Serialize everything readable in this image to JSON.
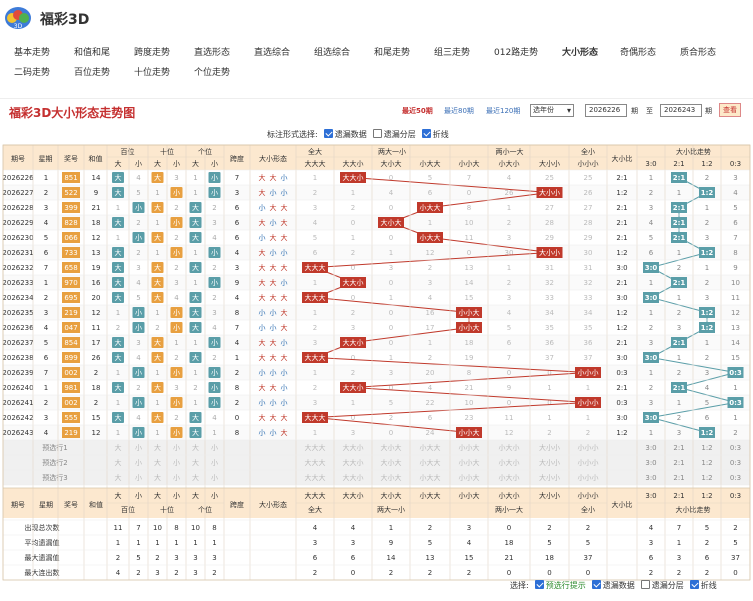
{
  "app": {
    "title": "福彩3D"
  },
  "nav": {
    "row1": [
      "基本走势",
      "和值和尾",
      "跨度走势",
      "直选形态",
      "直选综合",
      "组选综合",
      "和尾走势",
      "组三走势",
      "012路走势",
      "大小形态",
      "奇偶形态",
      "质合形态"
    ],
    "row2": [
      "二码走势",
      "百位走势",
      "十位走势",
      "个位走势"
    ],
    "active": "大小形态"
  },
  "chart": {
    "title": "福彩3D大小形态走势图",
    "periods": [
      "最近50期",
      "最近80期",
      "最近120期"
    ],
    "active_period": "最近50期",
    "year_select": "选年份",
    "from_issue": "2026226",
    "to_issue": "2026243",
    "issue_suffix": "期",
    "to_label": "至",
    "query_label": "查看"
  },
  "options_top": {
    "label": "标注形式选择:",
    "items": [
      {
        "label": "遗漏数据",
        "checked": true
      },
      {
        "label": "遗漏分层",
        "checked": false
      },
      {
        "label": "折线",
        "checked": true
      }
    ]
  },
  "options_bottom": {
    "label": "选择:",
    "items": [
      {
        "label": "预选行提示",
        "checked": true,
        "accent": "#2e8b2e"
      },
      {
        "label": "遗漏数据",
        "checked": true
      },
      {
        "label": "遗漏分层",
        "checked": false
      },
      {
        "label": "折线",
        "checked": true
      }
    ]
  },
  "table": {
    "top_headers": {
      "issue": "期号",
      "week": "星期",
      "prize": "奖号",
      "sum": "和值",
      "hundreds": "百位",
      "tens": "十位",
      "units": "个位",
      "span": "跨度",
      "shape": "大小形态",
      "g_all_big": "全大",
      "g_2b1s": "两大一小",
      "g_2s1b": "两小一大",
      "g_all_small": "全小",
      "ratio": "大小比",
      "trend": "大小比走势"
    },
    "sub": {
      "big": "大",
      "small": "小",
      "all_big": "大大大",
      "s2b1s": [
        "大大小",
        "大小大",
        "小大大"
      ],
      "s2s1b": [
        "小小大",
        "小大小",
        "大小小"
      ],
      "all_small": "小小小",
      "trend": [
        "3:0",
        "2:1",
        "1:2",
        "0:3"
      ]
    },
    "rows": [
      {
        "issue": "2026226",
        "week": "1",
        "prize": "851",
        "sum": "14",
        "pos": [
          "大",
          "大",
          "小"
        ],
        "miss_b": [
          1,
          4
        ],
        "miss_t": [
          1,
          3
        ],
        "miss_u": [
          1,
          3
        ],
        "span": "7",
        "shape": [
          "大",
          "大",
          "小"
        ],
        "miss_shape": [
          1,
          0,
          5,
          7,
          4,
          25
        ],
        "ratio": "2:1",
        "trend_miss": [
          1,
          0,
          2,
          3
        ]
      },
      {
        "issue": "2026227",
        "week": "2",
        "prize": "522",
        "sum": "9",
        "pos": [
          "大",
          "小",
          "小"
        ],
        "miss_b": [
          2,
          5
        ],
        "miss_t": [
          1,
          1
        ],
        "miss_u": [
          1,
          1
        ],
        "span": "3",
        "shape": [
          "大",
          "小",
          "小"
        ],
        "miss_shape": [
          2,
          1,
          4,
          6,
          0,
          26
        ],
        "ratio": "1:2",
        "trend_miss": [
          2,
          1,
          0,
          4
        ]
      },
      {
        "issue": "2026228",
        "week": "3",
        "prize": "399",
        "sum": "21",
        "pos": [
          "小",
          "大",
          "大"
        ],
        "miss_b": [
          1,
          1
        ],
        "miss_t": [
          1,
          2
        ],
        "miss_u": [
          2,
          2
        ],
        "span": "6",
        "shape": [
          "小",
          "大",
          "大"
        ],
        "miss_shape": [
          3,
          2,
          0,
          8,
          1,
          27
        ],
        "ratio": "2:1",
        "trend_miss": [
          3,
          0,
          1,
          5
        ]
      },
      {
        "issue": "2026229",
        "week": "4",
        "prize": "828",
        "sum": "18",
        "pos": [
          "大",
          "小",
          "大"
        ],
        "miss_b": [
          2,
          2
        ],
        "miss_t": [
          1,
          1
        ],
        "miss_u": [
          3,
          3
        ],
        "span": "6",
        "shape": [
          "大",
          "小",
          "大"
        ],
        "miss_shape": [
          4,
          0,
          1,
          10,
          2,
          28
        ],
        "ratio": "2:1",
        "trend_miss": [
          4,
          0,
          2,
          6
        ]
      },
      {
        "issue": "2026230",
        "week": "5",
        "prize": "066",
        "sul": "",
        "sum": "12",
        "pos": [
          "小",
          "大",
          "大"
        ],
        "miss_b": [
          1,
          1
        ],
        "miss_t": [
          2,
          2
        ],
        "miss_u": [
          4,
          4
        ],
        "span": "6",
        "shape": [
          "小",
          "大",
          "大"
        ],
        "miss_shape": [
          5,
          1,
          0,
          11,
          3,
          29
        ],
        "ratio": "2:1",
        "trend_miss": [
          5,
          0,
          3,
          7
        ]
      },
      {
        "issue": "2026231",
        "week": "6",
        "prize": "733",
        "sum": "13",
        "pos": [
          "大",
          "小",
          "小"
        ],
        "miss_b": [
          1,
          2
        ],
        "miss_t": [
          1,
          1
        ],
        "miss_u": [
          1,
          1
        ],
        "span": "4",
        "shape": [
          "大",
          "小",
          "小"
        ],
        "miss_shape": [
          6,
          2,
          1,
          12,
          0,
          30
        ],
        "ratio": "1:2",
        "trend_miss": [
          6,
          1,
          0,
          8
        ]
      },
      {
        "issue": "2026232",
        "week": "7",
        "prize": "658",
        "sum": "19",
        "pos": [
          "大",
          "大",
          "大"
        ],
        "miss_b": [
          2,
          3
        ],
        "miss_t": [
          1,
          2
        ],
        "miss_u": [
          1,
          2
        ],
        "span": "3",
        "shape": [
          "大",
          "大",
          "大"
        ],
        "miss_shape": [
          0,
          3,
          2,
          13,
          1,
          31
        ],
        "ratio": "3:0",
        "trend_miss": [
          0,
          2,
          1,
          9
        ]
      },
      {
        "issue": "2026233",
        "week": "1",
        "prize": "970",
        "sum": "16",
        "pos": [
          "大",
          "大",
          "小"
        ],
        "miss_b": [
          3,
          4
        ],
        "miss_t": [
          2,
          3
        ],
        "miss_u": [
          1,
          1
        ],
        "span": "9",
        "shape": [
          "大",
          "大",
          "小"
        ],
        "miss_shape": [
          1,
          0,
          3,
          14,
          2,
          32
        ],
        "ratio": "2:1",
        "trend_miss": [
          1,
          0,
          2,
          10
        ]
      },
      {
        "issue": "2026234",
        "week": "2",
        "prize": "695",
        "sum": "20",
        "pos": [
          "大",
          "大",
          "大"
        ],
        "miss_b": [
          4,
          5
        ],
        "miss_t": [
          3,
          4
        ],
        "miss_u": [
          1,
          2
        ],
        "span": "4",
        "shape": [
          "大",
          "大",
          "大"
        ],
        "miss_shape": [
          0,
          1,
          4,
          15,
          3,
          33
        ],
        "ratio": "3:0",
        "trend_miss": [
          0,
          1,
          3,
          11
        ]
      },
      {
        "issue": "2026235",
        "week": "3",
        "prize": "219",
        "sum": "12",
        "pos": [
          "小",
          "小",
          "大"
        ],
        "miss_b": [
          1,
          1
        ],
        "miss_t": [
          1,
          1
        ],
        "miss_u": [
          2,
          3
        ],
        "span": "8",
        "shape": [
          "小",
          "小",
          "大"
        ],
        "miss_shape": [
          1,
          2,
          0,
          16,
          4,
          34
        ],
        "ratio": "1:2",
        "trend_miss": [
          1,
          2,
          0,
          12
        ]
      },
      {
        "issue": "2026236",
        "week": "4",
        "prize": "047",
        "sum": "11",
        "pos": [
          "小",
          "小",
          "大"
        ],
        "miss_b": [
          2,
          2
        ],
        "miss_t": [
          2,
          2
        ],
        "miss_u": [
          3,
          4
        ],
        "span": "7",
        "shape": [
          "小",
          "小",
          "大"
        ],
        "miss_shape": [
          2,
          3,
          0,
          17,
          5,
          35
        ],
        "ratio": "1:2",
        "trend_miss": [
          2,
          3,
          0,
          13
        ]
      },
      {
        "issue": "2026237",
        "week": "5",
        "prize": "854",
        "sum": "17",
        "pos": [
          "大",
          "大",
          "小"
        ],
        "miss_b": [
          1,
          3
        ],
        "miss_t": [
          1,
          1
        ],
        "miss_u": [
          1,
          1
        ],
        "span": "4",
        "shape": [
          "大",
          "大",
          "小"
        ],
        "miss_shape": [
          3,
          0,
          1,
          18,
          6,
          36
        ],
        "ratio": "2:1",
        "trend_miss": [
          3,
          0,
          1,
          14
        ]
      },
      {
        "issue": "2026238",
        "week": "6",
        "prize": "899",
        "sum": "26",
        "pos": [
          "大",
          "大",
          "大"
        ],
        "miss_b": [
          2,
          4
        ],
        "miss_t": [
          2,
          2
        ],
        "miss_u": [
          1,
          2
        ],
        "span": "1",
        "shape": [
          "大",
          "大",
          "大"
        ],
        "miss_shape": [
          0,
          1,
          2,
          19,
          7,
          37
        ],
        "ratio": "3:0",
        "trend_miss": [
          0,
          1,
          2,
          15
        ]
      },
      {
        "issue": "2026239",
        "week": "7",
        "prize": "002",
        "sum": "2",
        "pos": [
          "小",
          "小",
          "小"
        ],
        "miss_b": [
          1,
          1
        ],
        "miss_t": [
          1,
          1
        ],
        "miss_u": [
          1,
          1
        ],
        "span": "2",
        "shape": [
          "小",
          "小",
          "小"
        ],
        "miss_shape": [
          1,
          2,
          3,
          20,
          8,
          0
        ],
        "ratio": "0:3",
        "trend_miss": [
          1,
          2,
          3,
          0
        ]
      },
      {
        "issue": "2026240",
        "week": "1",
        "prize": "981",
        "sum": "18",
        "pos": [
          "大",
          "大",
          "小"
        ],
        "miss_b": [
          2,
          2
        ],
        "miss_t": [
          2,
          3
        ],
        "miss_u": [
          2,
          2
        ],
        "span": "8",
        "shape": [
          "大",
          "大",
          "小"
        ],
        "miss_shape": [
          2,
          0,
          4,
          21,
          9,
          1
        ],
        "ratio": "2:1",
        "trend_miss": [
          2,
          0,
          4,
          1
        ]
      },
      {
        "issue": "2026241",
        "week": "2",
        "prize": "002",
        "sum": "2",
        "pos": [
          "小",
          "小",
          "小"
        ],
        "miss_b": [
          1,
          1
        ],
        "miss_t": [
          1,
          1
        ],
        "miss_u": [
          1,
          3
        ],
        "span": "2",
        "shape": [
          "小",
          "小",
          "小"
        ],
        "miss_shape": [
          3,
          1,
          5,
          22,
          10,
          0
        ],
        "ratio": "0:3",
        "trend_miss": [
          3,
          1,
          5,
          0
        ]
      },
      {
        "issue": "2026242",
        "week": "3",
        "prize": "555",
        "sum": "15",
        "pos": [
          "大",
          "大",
          "大"
        ],
        "miss_b": [
          2,
          4
        ],
        "miss_t": [
          1,
          2
        ],
        "miss_u": [
          1,
          4
        ],
        "span": "0",
        "shape": [
          "大",
          "大",
          "大"
        ],
        "miss_shape": [
          0,
          2,
          6,
          23,
          11,
          1
        ],
        "ratio": "3:0",
        "trend_miss": [
          0,
          2,
          6,
          1
        ]
      },
      {
        "issue": "2026243",
        "week": "4",
        "prize": "219",
        "sum": "12",
        "pos": [
          "小",
          "小",
          "大"
        ],
        "miss_b": [
          1,
          1
        ],
        "miss_t": [
          1,
          1
        ],
        "miss_u": [
          1,
          1
        ],
        "span": "8",
        "shape": [
          "小",
          "小",
          "大"
        ],
        "miss_shape": [
          1,
          3,
          0,
          24,
          12,
          2
        ],
        "ratio": "1:2",
        "trend_miss": [
          1,
          3,
          0,
          2
        ]
      }
    ],
    "preselect": [
      "预选行1",
      "预选行2",
      "预选行3"
    ],
    "bottom_headers": {
      "group_all_big": "全大",
      "group_2b1s": "两大一小",
      "group_2s1b": "两小一大",
      "group_all_small": "全小"
    },
    "stats": [
      {
        "label": "出现总次数",
        "pos": [
          11,
          7,
          10,
          8,
          10,
          8
        ],
        "shape": [
          4,
          4,
          1,
          2,
          3,
          0,
          2,
          2
        ],
        "trend": [
          4,
          7,
          5,
          2
        ]
      },
      {
        "label": "平均遗漏值",
        "pos": [
          1,
          1,
          1,
          1,
          1,
          1
        ],
        "shape": [
          3,
          3,
          9,
          5,
          4,
          18,
          5,
          5
        ],
        "trend": [
          3,
          1,
          2,
          5
        ]
      },
      {
        "label": "最大遗漏值",
        "pos": [
          2,
          5,
          2,
          3,
          3,
          3
        ],
        "shape": [
          6,
          6,
          14,
          13,
          15,
          21,
          18,
          37
        ],
        "trend": [
          6,
          3,
          6,
          37
        ]
      },
      {
        "label": "最大连出数",
        "pos": [
          4,
          2,
          3,
          2,
          3,
          2
        ],
        "shape": [
          2,
          0,
          2,
          2,
          2,
          0,
          0,
          0
        ],
        "trend": [
          2,
          2,
          2,
          0
        ]
      }
    ]
  },
  "colors": {
    "red": "#c0392b",
    "blue": "#2b6cb0",
    "orange": "#e8a040",
    "teal": "#5a9ea8",
    "header_bg": "#fce8cf"
  }
}
